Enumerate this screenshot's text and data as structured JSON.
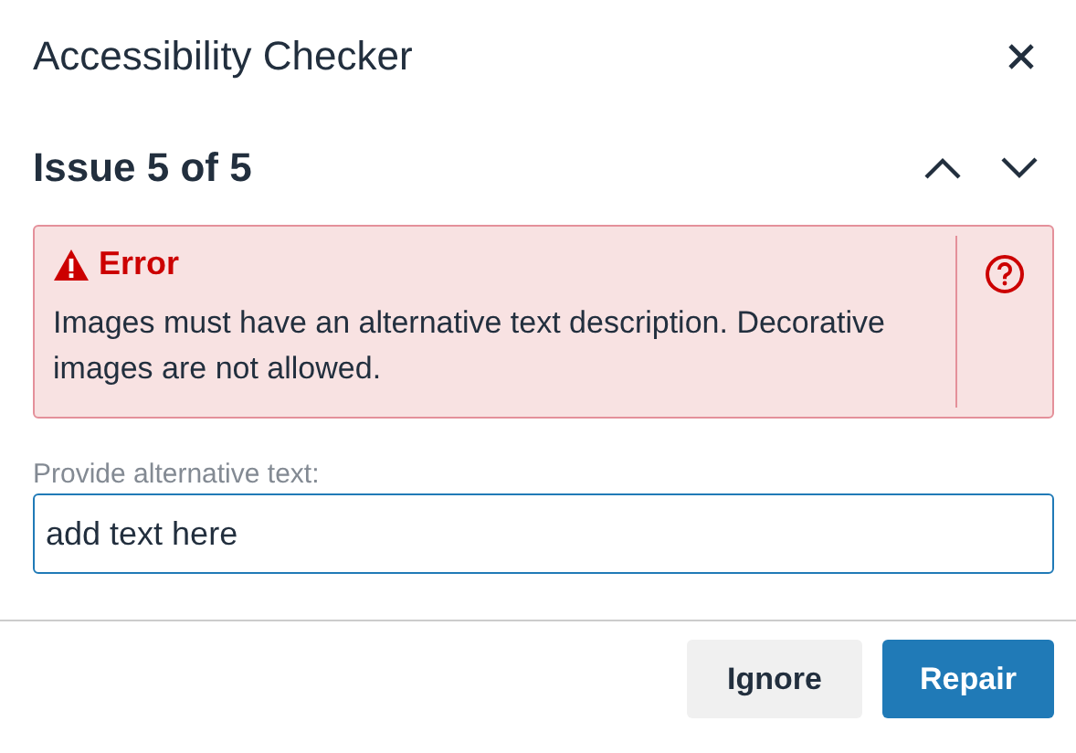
{
  "window": {
    "title": "Accessibility Checker"
  },
  "issue": {
    "heading": "Issue 5 of 5"
  },
  "alert": {
    "kind": "error",
    "label": "Error",
    "message": "Images must have an alternative text description. Decorative images are not allowed."
  },
  "field": {
    "label": "Provide alternative text:",
    "value": "add text here"
  },
  "buttons": [
    {
      "label": "Ignore",
      "kind": "secondary"
    },
    {
      "label": "Repair",
      "kind": "primary"
    }
  ]
}
